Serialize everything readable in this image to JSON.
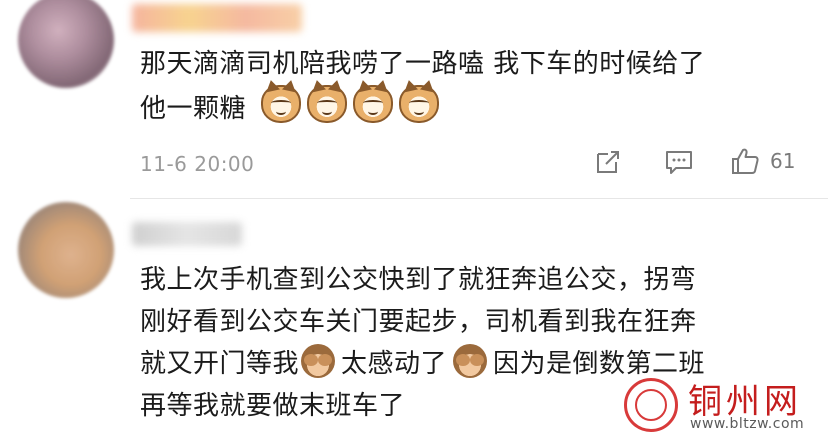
{
  "comments": [
    {
      "text_line1": "那天滴滴司机陪我唠了一路嗑 我下车的时候给了",
      "text_line2": "他一颗糖",
      "emoji": [
        "cat-face-emoji",
        "cat-face-emoji",
        "cat-face-emoji",
        "cat-face-emoji"
      ],
      "timestamp": "11-6 20:00",
      "like_count": "61"
    },
    {
      "text_line1": "我上次手机查到公交快到了就狂奔追公交，拐弯",
      "text_line2": "刚好看到公交车关门要起步，司机看到我在狂奔",
      "text_line3a": "就又开门等我",
      "text_line3b": "太感动了",
      "text_line3c": "因为是倒数第二班",
      "text_line4": "再等我就要做末班车了"
    }
  ],
  "icons": {
    "share": "share-icon",
    "comment": "comment-icon",
    "like": "thumbs-up-icon"
  },
  "watermark": {
    "title": "铜州网",
    "url": "www.bltzw.com"
  },
  "colors": {
    "watermark_red": "#c41d1d",
    "meta_gray": "#9a9a9a"
  }
}
